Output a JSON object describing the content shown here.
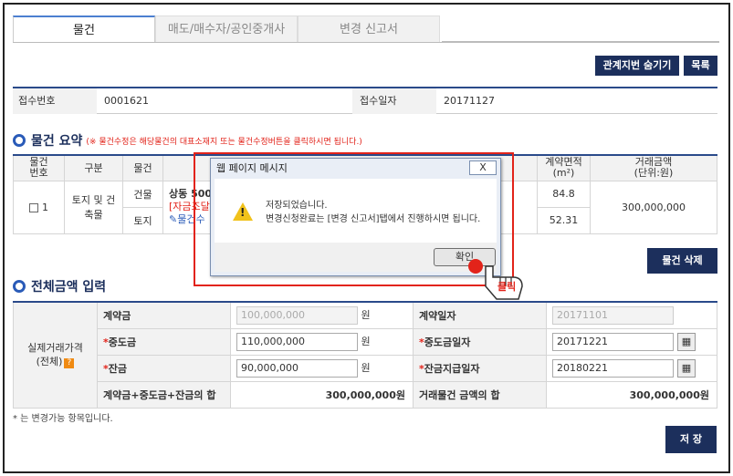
{
  "tabs": [
    "물건",
    "매도/매수자/공인중개사",
    "변경 신고서"
  ],
  "buttons": {
    "related": "관계지번 숨기기",
    "list": "목록",
    "delete": "물건 삭제",
    "save": "저 장"
  },
  "info": {
    "receipt_no_label": "접수번호",
    "receipt_no": "0001621",
    "receipt_date_label": "접수일자",
    "receipt_date": "20171127"
  },
  "summary": {
    "title": "물건 요약",
    "note": "(※ 물건수정은 해당물건의 대표소재지 또는 물건수정버튼을 클릭하시면 됩니다.)",
    "headers": {
      "no": "물건\n번호",
      "type": "구분",
      "item": "물건",
      "area": "계약면적",
      "area_unit": "(m²)",
      "amount": "거래금액",
      "amount_unit": "(단위:원)"
    },
    "row": {
      "no": "1",
      "kind": "토지 및 건축물",
      "building": "건물",
      "land": "토지",
      "addr": "상동 500",
      "funding": "[자금조달",
      "edit": "물건수",
      "area1": "84.8",
      "area2": "52.31",
      "amount": "300,000,000"
    }
  },
  "total": {
    "title": "전체금액 입력",
    "group": "실제거래가격",
    "group2": "(전체)",
    "contract_label": "계약금",
    "contract": "100,000,000",
    "middle_label": "중도금",
    "middle": "110,000,000",
    "balance_label": "잔금",
    "balance": "90,000,000",
    "won": "원",
    "date_label": "계약일자",
    "date": "20171101",
    "middle_date_label": "중도금일자",
    "middle_date": "20171221",
    "balance_date_label": "잔금지급일자",
    "balance_date": "20180221",
    "sum_label": "계약금+중도금+잔금의 합",
    "sum": "300,000,000원",
    "trade_label": "거래물건 금액의 합",
    "trade": "300,000,000원"
  },
  "footnote": "* 는 변경가능 항목입니다.",
  "dialog": {
    "title": "웹 페이지 메시지",
    "line1": "저장되었습니다.",
    "line2": "변경신청완료는 [변경 신고서]탭에서 진행하시면 됩니다.",
    "ok": "확인",
    "close": "X"
  },
  "click_label": "클릭"
}
